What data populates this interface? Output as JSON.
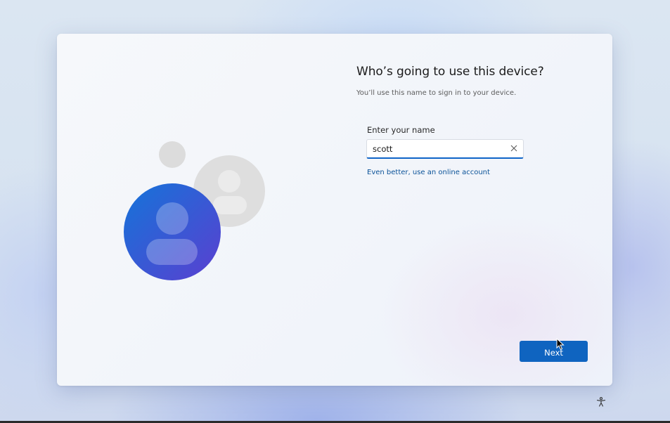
{
  "setup": {
    "title": "Who’s going to use this device?",
    "subtitle": "You’ll use this name to sign in to your device.",
    "name_field": {
      "label": "Enter your name",
      "value": "scott",
      "clear_icon": "close-icon"
    },
    "online_account_link": "Even better, use an online account",
    "next_button": "Next"
  },
  "illustration": {
    "front_user_icon": "user-icon",
    "back_user_icon": "user-icon",
    "colors": {
      "front_gradient_start": "#1474d9",
      "front_gradient_end": "#5b3fd0",
      "back_circle": "#dedede"
    }
  },
  "taskbar": {
    "accessibility_icon": "accessibility-icon"
  },
  "colors": {
    "accent": "#0f64c0",
    "link": "#0b5298"
  }
}
